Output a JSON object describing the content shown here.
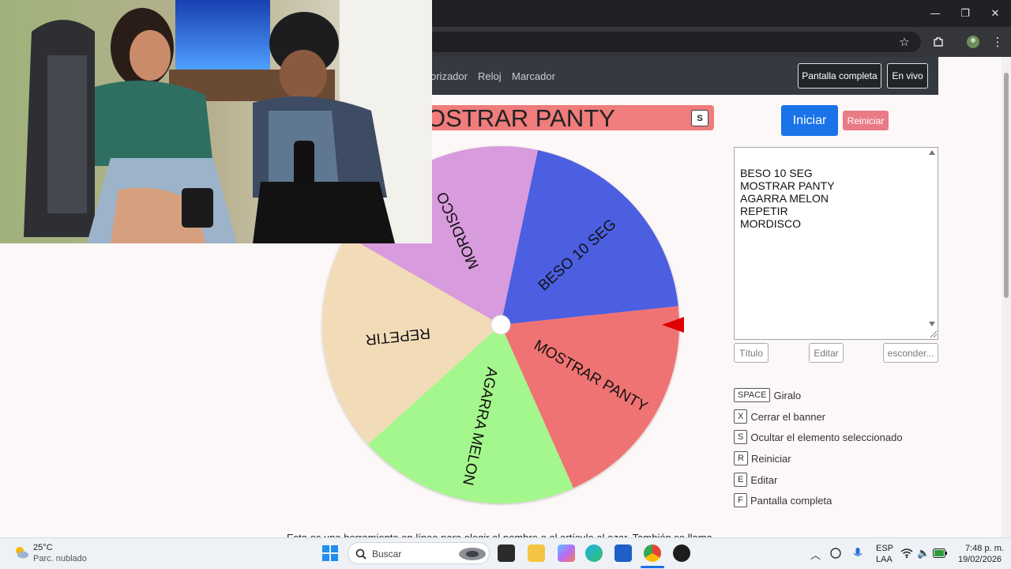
{
  "browser": {
    "window_controls": {
      "minimize": "—",
      "maximize": "❐",
      "close": "✕"
    }
  },
  "nav": {
    "links": [
      "orizador",
      "Reloj",
      "Marcador"
    ],
    "fullscreen_label": "Pantalla completa",
    "live_label": "En vivo"
  },
  "banner": {
    "text": "OSTRAR PANTY",
    "hide_key": "S"
  },
  "wheel": {
    "slices": [
      {
        "label": "BESO 10 SEG",
        "color": "#4b5ee0"
      },
      {
        "label": "MOSTRAR PANTY",
        "color": "#f07373"
      },
      {
        "label": "AGARRA MELON",
        "color": "#a4f78c"
      },
      {
        "label": "REPETIR",
        "color": "#f2dcb8"
      },
      {
        "label": "MORDISCO",
        "color": "#d89bdd"
      }
    ],
    "pointer_color": "#e00000"
  },
  "controls": {
    "start_label": "Iniciar",
    "reset_label": "Reiniciar",
    "start_color": "#1a73e8",
    "reset_color": "#e97a86"
  },
  "entries": [
    "BESO 10 SEG",
    "MOSTRAR PANTY",
    "AGARRA MELON",
    "REPETIR",
    "MORDISCO"
  ],
  "entry_buttons": {
    "title": "Título",
    "edit": "Editar",
    "hide": "esconder..."
  },
  "shortcuts": [
    {
      "key": "SPACE",
      "label": "Giralo"
    },
    {
      "key": "X",
      "label": "Cerrar el banner"
    },
    {
      "key": "S",
      "label": "Ocultar el elemento seleccionado"
    },
    {
      "key": "R",
      "label": "Reiniciar"
    },
    {
      "key": "E",
      "label": "Editar"
    },
    {
      "key": "F",
      "label": "Pantalla completa"
    }
  ],
  "footer_text": "Esta es una herramienta en línea para elegir el nombre o el artículo al azar. También se llama",
  "taskbar": {
    "weather_temp": "25°C",
    "weather_desc": "Parc. nublado",
    "search_placeholder": "Buscar",
    "language": "ESP",
    "layout": "LAA",
    "time": "7:48 p. m.",
    "date": "19/02/2026"
  }
}
